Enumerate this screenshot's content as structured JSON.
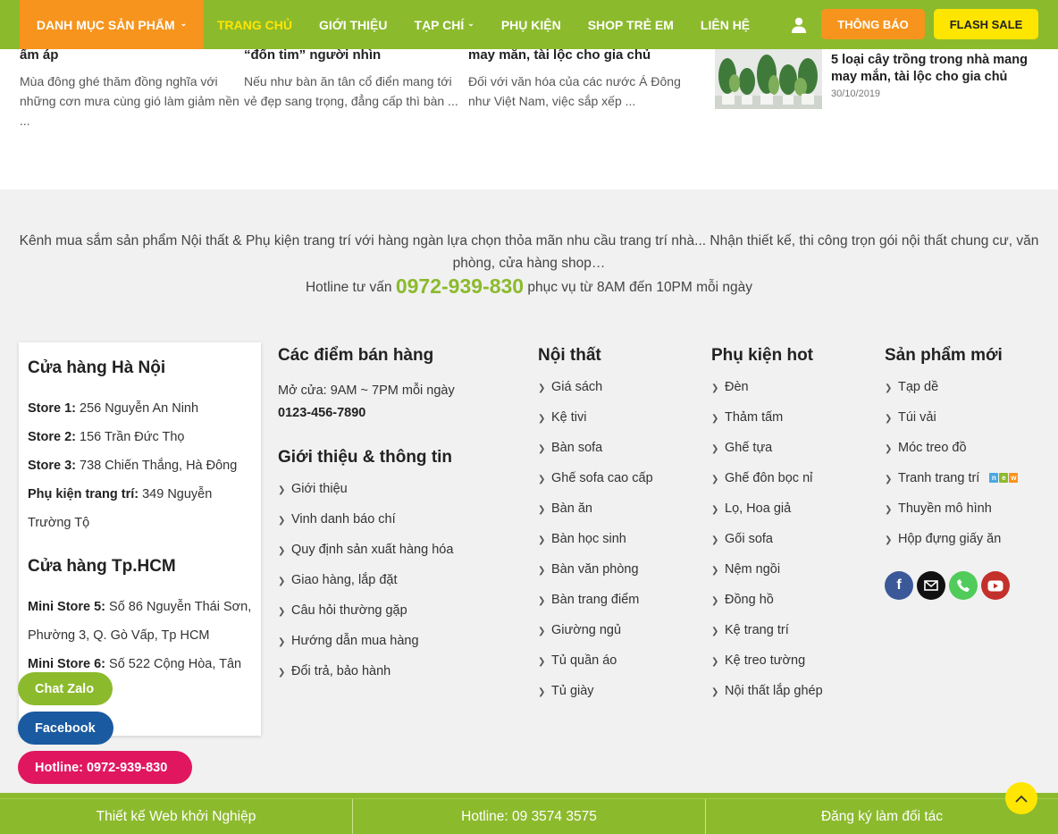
{
  "navbar": {
    "category_label": "DANH MỤC SẢN PHẨM",
    "links": [
      {
        "label": "TRANG CHỦ"
      },
      {
        "label": "GIỚI THIỆU"
      },
      {
        "label": "TẠP CHÍ"
      },
      {
        "label": "PHỤ KIỆN"
      },
      {
        "label": "SHOP TRẺ EM"
      },
      {
        "label": "LIÊN HỆ"
      }
    ],
    "notice_label": "THÔNG BÁO",
    "flash_label": "FLASH SALE",
    "colors": {
      "bar": "#8cba2d",
      "category": "#f7941d",
      "active": "#ffe600"
    }
  },
  "articles": [
    {
      "title": "ấm áp",
      "excerpt": "Mùa đông ghé thăm đồng nghĩa với những cơn mưa cùng gió làm giảm nền ..."
    },
    {
      "title": "“đốn tim” người nhìn",
      "excerpt": "Nếu như bàn ăn tân cổ điển mang tới vẻ đẹp sang trọng, đẳng cấp thì bàn ..."
    },
    {
      "title": "may mắn, tài lộc cho gia chủ",
      "excerpt": "Đối với văn hóa của các nước Á Đông như Việt Nam, việc sắp xếp ..."
    }
  ],
  "side_article": {
    "title": "5 loại cây trồng trong nhà mang may mắn, tài lộc cho gia chủ",
    "date": "30/10/2019"
  },
  "footer": {
    "intro": "Kênh mua sắm sản phẩm Nội thất & Phụ kiện trang trí với hàng ngàn lựa chọn thỏa mãn nhu cầu trang trí nhà... Nhận thiết kế, thi công trọn gói nội thất chung cư, văn phòng, cửa hàng shop…",
    "hotline_prefix": "Hotline tư vấn",
    "hotline_number": "0972-939-830",
    "hotline_suffix": "phục vụ từ 8AM đến 10PM mỗi ngày",
    "hanoi": {
      "title": "Cửa hàng Hà Nội",
      "stores": [
        {
          "label": "Store 1:",
          "addr": "256 Nguyễn An Ninh"
        },
        {
          "label": "Store 2:",
          "addr": "156 Trần Đức Thọ"
        },
        {
          "label": "Store 3:",
          "addr": "738 Chiến Thắng, Hà Đông"
        },
        {
          "label": "Phụ kiện trang trí:",
          "addr": "349 Nguyễn Trường Tộ"
        }
      ]
    },
    "hcm": {
      "title": "Cửa hàng Tp.HCM",
      "stores": [
        {
          "label": "Mini Store 5:",
          "addr": "Số 86 Nguyễn Thái Sơn, Phường 3, Q. Gò Vấp, Tp HCM"
        },
        {
          "label": "Mini Store 6:",
          "addr": "Số 522 Cộng Hòa, Tân Bình, Tp HCM"
        }
      ]
    },
    "points": {
      "title": "Các điểm bán hàng",
      "hours": "Mở cửa: 9AM ~ 7PM mỗi ngày",
      "phone": "0123-456-7890"
    },
    "info": {
      "title": "Giới thiệu & thông tin",
      "items": [
        "Giới thiệu",
        "Vinh danh báo chí",
        "Quy định sản xuất hàng hóa",
        "Giao hàng, lắp đặt",
        "Câu hỏi thường gặp",
        "Hướng dẫn mua hàng",
        "Đổi trả, bảo hành"
      ]
    },
    "noithat": {
      "title": "Nội thất",
      "items": [
        "Giá sách",
        "Kệ tivi",
        "Bàn sofa",
        "Ghế sofa cao cấp",
        "Bàn ăn",
        "Bàn học sinh",
        "Bàn văn phòng",
        "Bàn trang điểm",
        "Giường ngủ",
        "Tủ quần áo",
        "Tủ giày"
      ]
    },
    "phukien": {
      "title": "Phụ kiện hot",
      "items": [
        "Đèn",
        "Thảm tấm",
        "Ghế tựa",
        "Ghế đôn bọc nỉ",
        "Lọ, Hoa giả",
        "Gối sofa",
        "Nệm ngồi",
        "Đồng hồ",
        "Kệ trang trí",
        "Kệ treo tường",
        "Nội thất lắp ghép"
      ]
    },
    "sanpham": {
      "title": "Sản phẩm mới",
      "items": [
        "Tạp dề",
        "Túi vải",
        "Móc treo đồ",
        "Tranh trang trí",
        "Thuyền mô hình",
        "Hộp đựng giấy ăn"
      ]
    }
  },
  "floating": {
    "zalo": "Chat Zalo",
    "facebook": "Facebook",
    "hotline": "Hotline: 0972-939-830"
  },
  "bottom": {
    "left": "Thiết kế Web khởi Nghiệp",
    "center": "Hotline: 09 3574 3575",
    "right": "Đăng ký làm đối tác"
  }
}
